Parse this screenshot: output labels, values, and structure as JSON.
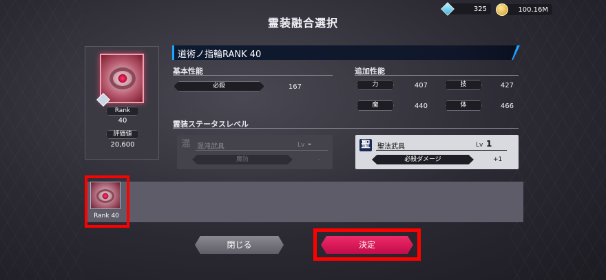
{
  "currency": {
    "gem_icon": "diamond-gem-icon",
    "gem_value": "325",
    "coin_icon": "gold-coin-icon",
    "coin_value": "100.16M"
  },
  "title": "霊装融合選択",
  "card": {
    "rank_label": "Rank",
    "rank_value": "40",
    "rating_label": "評価値",
    "rating_value": "20,600"
  },
  "item_name": "道術ノ指輪RANK 40",
  "basic": {
    "heading": "基本性能",
    "stat_label": "必殺",
    "stat_value": "167"
  },
  "additional": {
    "heading": "追加性能",
    "stats": [
      {
        "label": "力",
        "value": "407"
      },
      {
        "label": "技",
        "value": "427"
      },
      {
        "label": "魔",
        "value": "440"
      },
      {
        "label": "体",
        "value": "466"
      }
    ]
  },
  "status_level": {
    "heading": "霊装ステータスレベル",
    "boxes": [
      {
        "kanji": "混",
        "title": "混沌武具",
        "lv_label": "Lv",
        "lv_value": "-",
        "stat_label": "魔防",
        "stat_value": "-"
      },
      {
        "kanji": "聖",
        "title": "聖法武具",
        "lv_label": "Lv",
        "lv_value": "1",
        "stat_label": "必殺ダメージ",
        "stat_value": "+1"
      }
    ]
  },
  "selection": {
    "items": [
      {
        "label": "Rank 40"
      }
    ]
  },
  "buttons": {
    "close": "閉じる",
    "decide": "決定"
  },
  "colors": {
    "accent_blue": "#1aa6ff",
    "decide_pink": "#e8195e",
    "highlight_red": "#ff0000"
  }
}
